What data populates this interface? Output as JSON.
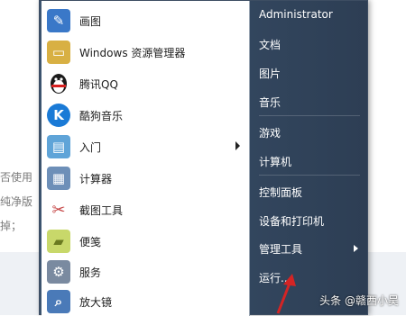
{
  "background": {
    "fragments": [
      "否使用",
      "纯净版",
      "掉；"
    ]
  },
  "programs": [
    {
      "label": "画图",
      "icon": "paint-palette-icon",
      "color": "#3a78c8"
    },
    {
      "label": "Windows 资源管理器",
      "icon": "folder-explorer-icon",
      "color": "#d8b043"
    },
    {
      "label": "腾讯QQ",
      "icon": "qq-penguin-icon",
      "color": "#1b1b1b"
    },
    {
      "label": "酷狗音乐",
      "icon": "kugou-k-icon",
      "color": "#1a7ad6"
    },
    {
      "label": "入门",
      "icon": "getting-started-icon",
      "color": "#5fa4d8",
      "submenu": true
    },
    {
      "label": "计算器",
      "icon": "calculator-icon",
      "color": "#6d8fb8"
    },
    {
      "label": "截图工具",
      "icon": "scissors-icon",
      "color": "#c64848"
    },
    {
      "label": "便笺",
      "icon": "sticky-note-icon",
      "color": "#c8d86a"
    },
    {
      "label": "服务",
      "icon": "gears-icon",
      "color": "#7a8aa0"
    },
    {
      "label": "放大镜",
      "icon": "magnifier-icon",
      "color": "#4a7ab8"
    }
  ],
  "right_items": {
    "user": "Administrator",
    "documents": "文档",
    "pictures": "图片",
    "music": "音乐",
    "games": "游戏",
    "computer": "计算机",
    "control_panel": "控制面板",
    "devices_printers": "设备和打印机",
    "admin_tools": "管理工具",
    "run": "运行..."
  },
  "watermark": "头条 @赣西小吴"
}
